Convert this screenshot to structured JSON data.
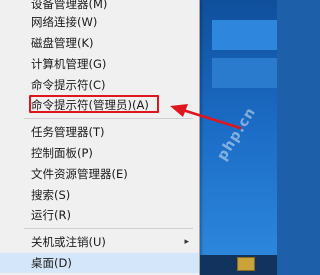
{
  "menu": {
    "items": [
      {
        "label": "设备管理器(M)"
      },
      {
        "label": "网络连接(W)"
      },
      {
        "label": "磁盘管理(K)"
      },
      {
        "label": "计算机管理(G)"
      },
      {
        "label": "命令提示符(C)"
      },
      {
        "label": "命令提示符(管理员)(A)"
      },
      {
        "label": "任务管理器(T)"
      },
      {
        "label": "控制面板(P)"
      },
      {
        "label": "文件资源管理器(E)"
      },
      {
        "label": "搜索(S)"
      },
      {
        "label": "运行(R)"
      },
      {
        "label": "关机或注销(U)",
        "submenu_arrow": "▸"
      },
      {
        "label": "桌面(D)"
      }
    ]
  },
  "watermark": "php.cn",
  "colors": {
    "highlight_box": "#e0161e",
    "arrow": "#e0161e",
    "menu_bg": "#f0f0f0"
  }
}
